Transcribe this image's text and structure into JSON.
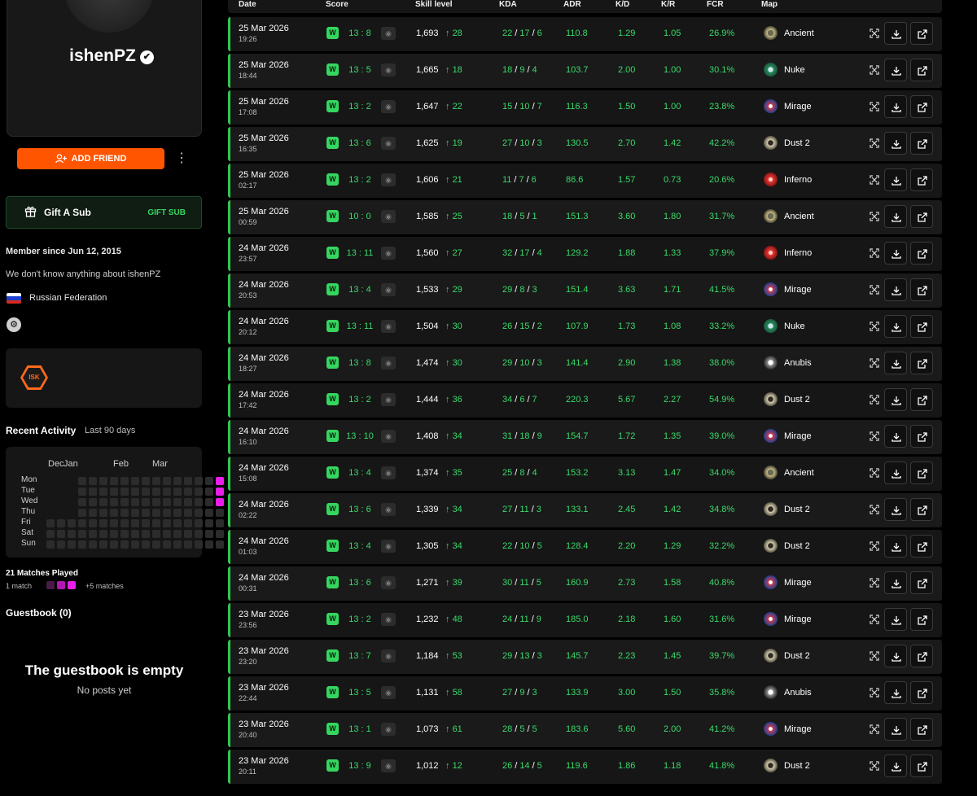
{
  "profile": {
    "username": "ishenPZ",
    "add_friend_label": "ADD FRIEND",
    "gift_label": "Gift A Sub",
    "gift_action": "GIFT SUB",
    "member_since": "Member since Jun 12, 2015",
    "about": "We don't know anything about ishenPZ",
    "country": "Russian Federation",
    "team_logo_text": "ISK"
  },
  "activity": {
    "title": "Recent Activity",
    "subtitle": "Last 90 days",
    "months": [
      "Dec",
      "Jan",
      "Feb",
      "Mar"
    ],
    "days": [
      "Mon",
      "Tue",
      "Wed",
      "Thu",
      "Fri",
      "Sat",
      "Sun"
    ],
    "matches_played": "21 Matches Played",
    "legend_low": "1 match",
    "legend_high": "+5 matches"
  },
  "guestbook": {
    "title": "Guestbook (0)",
    "empty_title": "The guestbook is empty",
    "empty_sub": "No posts yet"
  },
  "table": {
    "headers": [
      "Date",
      "Score",
      "Skill level",
      "KDA",
      "ADR",
      "K/D",
      "K/R",
      "FCR",
      "Map"
    ],
    "result_label": "W",
    "rows": [
      {
        "date": "25 Mar 2026",
        "time": "19:26",
        "score": "13 : 8",
        "elo": "1,693",
        "gain": "28",
        "k": "22",
        "d": "17",
        "a": "6",
        "adr": "110.8",
        "kd": "1.29",
        "kr": "1.05",
        "fcr": "26.9%",
        "map": "Ancient"
      },
      {
        "date": "25 Mar 2026",
        "time": "18:44",
        "score": "13 : 5",
        "elo": "1,665",
        "gain": "18",
        "k": "18",
        "d": "9",
        "a": "4",
        "adr": "103.7",
        "kd": "2.00",
        "kr": "1.00",
        "fcr": "30.1%",
        "map": "Nuke"
      },
      {
        "date": "25 Mar 2026",
        "time": "17:08",
        "score": "13 : 2",
        "elo": "1,647",
        "gain": "22",
        "k": "15",
        "d": "10",
        "a": "7",
        "adr": "116.3",
        "kd": "1.50",
        "kr": "1.00",
        "fcr": "23.8%",
        "map": "Mirage"
      },
      {
        "date": "25 Mar 2026",
        "time": "16:35",
        "score": "13 : 6",
        "elo": "1,625",
        "gain": "19",
        "k": "27",
        "d": "10",
        "a": "3",
        "adr": "130.5",
        "kd": "2.70",
        "kr": "1.42",
        "fcr": "42.2%",
        "map": "Dust 2"
      },
      {
        "date": "25 Mar 2026",
        "time": "02:17",
        "score": "13 : 2",
        "elo": "1,606",
        "gain": "21",
        "k": "11",
        "d": "7",
        "a": "6",
        "adr": "86.6",
        "kd": "1.57",
        "kr": "0.73",
        "fcr": "20.6%",
        "map": "Inferno"
      },
      {
        "date": "25 Mar 2026",
        "time": "00:59",
        "score": "10 : 0",
        "elo": "1,585",
        "gain": "25",
        "k": "18",
        "d": "5",
        "a": "1",
        "adr": "151.3",
        "kd": "3.60",
        "kr": "1.80",
        "fcr": "31.7%",
        "map": "Ancient"
      },
      {
        "date": "24 Mar 2026",
        "time": "23:57",
        "score": "13 : 11",
        "elo": "1,560",
        "gain": "27",
        "k": "32",
        "d": "17",
        "a": "4",
        "adr": "129.2",
        "kd": "1.88",
        "kr": "1.33",
        "fcr": "37.9%",
        "map": "Inferno"
      },
      {
        "date": "24 Mar 2026",
        "time": "20:53",
        "score": "13 : 4",
        "elo": "1,533",
        "gain": "29",
        "k": "29",
        "d": "8",
        "a": "3",
        "adr": "151.4",
        "kd": "3.63",
        "kr": "1.71",
        "fcr": "41.5%",
        "map": "Mirage"
      },
      {
        "date": "24 Mar 2026",
        "time": "20:12",
        "score": "13 : 11",
        "elo": "1,504",
        "gain": "30",
        "k": "26",
        "d": "15",
        "a": "2",
        "adr": "107.9",
        "kd": "1.73",
        "kr": "1.08",
        "fcr": "33.2%",
        "map": "Nuke"
      },
      {
        "date": "24 Mar 2026",
        "time": "18:27",
        "score": "13 : 8",
        "elo": "1,474",
        "gain": "30",
        "k": "29",
        "d": "10",
        "a": "3",
        "adr": "141.4",
        "kd": "2.90",
        "kr": "1.38",
        "fcr": "38.0%",
        "map": "Anubis"
      },
      {
        "date": "24 Mar 2026",
        "time": "17:42",
        "score": "13 : 2",
        "elo": "1,444",
        "gain": "36",
        "k": "34",
        "d": "6",
        "a": "7",
        "adr": "220.3",
        "kd": "5.67",
        "kr": "2.27",
        "fcr": "54.9%",
        "map": "Dust 2"
      },
      {
        "date": "24 Mar 2026",
        "time": "16:10",
        "score": "13 : 10",
        "elo": "1,408",
        "gain": "34",
        "k": "31",
        "d": "18",
        "a": "9",
        "adr": "154.7",
        "kd": "1.72",
        "kr": "1.35",
        "fcr": "39.0%",
        "map": "Mirage"
      },
      {
        "date": "24 Mar 2026",
        "time": "15:08",
        "score": "13 : 4",
        "elo": "1,374",
        "gain": "35",
        "k": "25",
        "d": "8",
        "a": "4",
        "adr": "153.2",
        "kd": "3.13",
        "kr": "1.47",
        "fcr": "34.0%",
        "map": "Ancient"
      },
      {
        "date": "24 Mar 2026",
        "time": "02:22",
        "score": "13 : 6",
        "elo": "1,339",
        "gain": "34",
        "k": "27",
        "d": "11",
        "a": "3",
        "adr": "133.1",
        "kd": "2.45",
        "kr": "1.42",
        "fcr": "34.8%",
        "map": "Dust 2"
      },
      {
        "date": "24 Mar 2026",
        "time": "01:03",
        "score": "13 : 4",
        "elo": "1,305",
        "gain": "34",
        "k": "22",
        "d": "10",
        "a": "5",
        "adr": "128.4",
        "kd": "2.20",
        "kr": "1.29",
        "fcr": "32.2%",
        "map": "Dust 2"
      },
      {
        "date": "24 Mar 2026",
        "time": "00:31",
        "score": "13 : 6",
        "elo": "1,271",
        "gain": "39",
        "k": "30",
        "d": "11",
        "a": "5",
        "adr": "160.9",
        "kd": "2.73",
        "kr": "1.58",
        "fcr": "40.8%",
        "map": "Mirage"
      },
      {
        "date": "23 Mar 2026",
        "time": "23:56",
        "score": "13 : 2",
        "elo": "1,232",
        "gain": "48",
        "k": "24",
        "d": "11",
        "a": "9",
        "adr": "185.0",
        "kd": "2.18",
        "kr": "1.60",
        "fcr": "31.6%",
        "map": "Mirage"
      },
      {
        "date": "23 Mar 2026",
        "time": "23:20",
        "score": "13 : 7",
        "elo": "1,184",
        "gain": "53",
        "k": "29",
        "d": "13",
        "a": "3",
        "adr": "145.7",
        "kd": "2.23",
        "kr": "1.45",
        "fcr": "39.7%",
        "map": "Dust 2"
      },
      {
        "date": "23 Mar 2026",
        "time": "22:44",
        "score": "13 : 5",
        "elo": "1,131",
        "gain": "58",
        "k": "27",
        "d": "9",
        "a": "3",
        "adr": "133.9",
        "kd": "3.00",
        "kr": "1.50",
        "fcr": "35.8%",
        "map": "Anubis"
      },
      {
        "date": "23 Mar 2026",
        "time": "20:40",
        "score": "13 : 1",
        "elo": "1,073",
        "gain": "61",
        "k": "28",
        "d": "5",
        "a": "5",
        "adr": "183.6",
        "kd": "5.60",
        "kr": "2.00",
        "fcr": "41.2%",
        "map": "Mirage"
      },
      {
        "date": "23 Mar 2026",
        "time": "20:11",
        "score": "13 : 9",
        "elo": "1,012",
        "gain": "12",
        "k": "26",
        "d": "14",
        "a": "5",
        "adr": "119.6",
        "kd": "1.86",
        "kr": "1.18",
        "fcr": "41.8%",
        "map": "Dust 2"
      }
    ]
  },
  "colors": {
    "accent": "#ff5500",
    "win": "#35d65f",
    "heat": "#e91ee8"
  }
}
